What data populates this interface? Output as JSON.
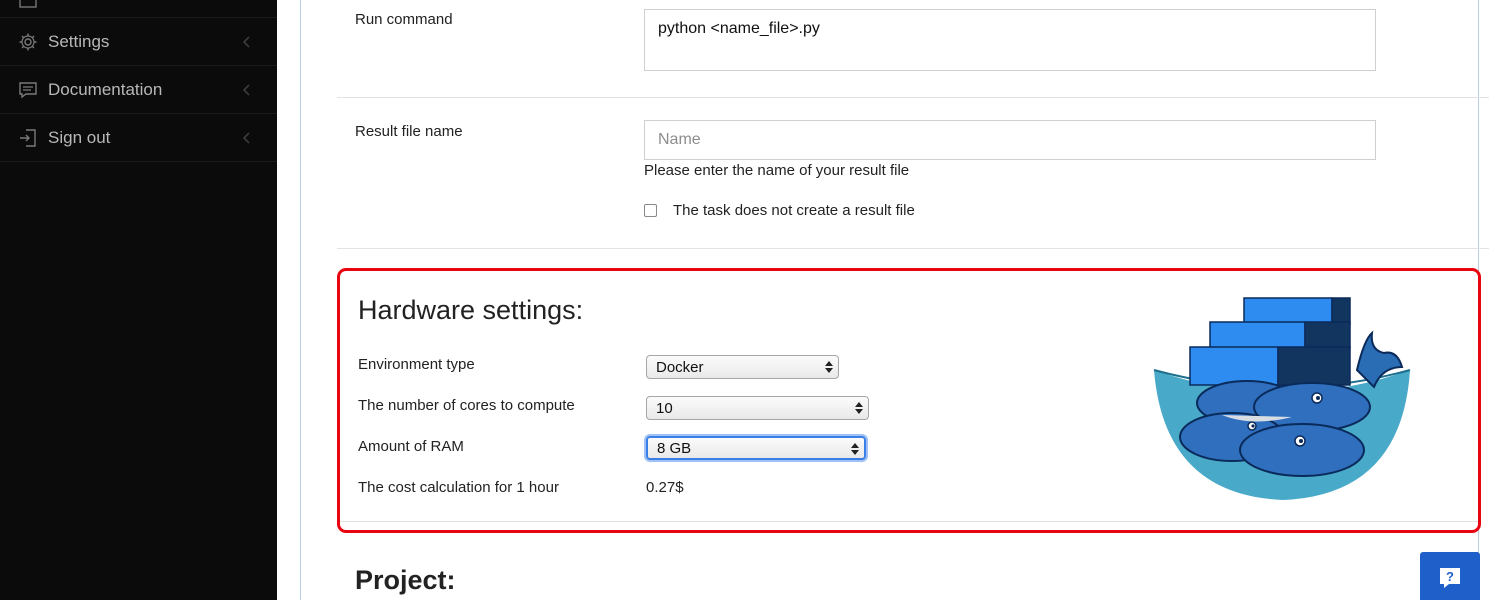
{
  "sidebar": {
    "items": [
      {
        "label": "Settings",
        "icon": "gear-icon"
      },
      {
        "label": "Documentation",
        "icon": "comment-icon"
      },
      {
        "label": "Sign out",
        "icon": "sign-out-icon"
      }
    ]
  },
  "form": {
    "run_command": {
      "label": "Run command",
      "value": "python <name_file>.py"
    },
    "result_file": {
      "label": "Result file name",
      "placeholder": "Name",
      "help": "Please enter the name of your result file",
      "checkbox_label": "The task does not create a result file",
      "checked": false
    }
  },
  "hardware": {
    "title": "Hardware settings:",
    "environment": {
      "label": "Environment type",
      "value": "Docker"
    },
    "cores": {
      "label": "The number of cores to compute",
      "value": "10"
    },
    "ram": {
      "label": "Amount of RAM",
      "value": "8 GB"
    },
    "cost": {
      "label": "The cost calculation for 1 hour",
      "value": "0.27$"
    }
  },
  "project": {
    "title": "Project:"
  },
  "colors": {
    "sidebar_bg": "#0b0b0b",
    "highlight_border": "#e8050f",
    "help_button": "#1f5fc9",
    "focus_ring": "#3a7ee7"
  }
}
